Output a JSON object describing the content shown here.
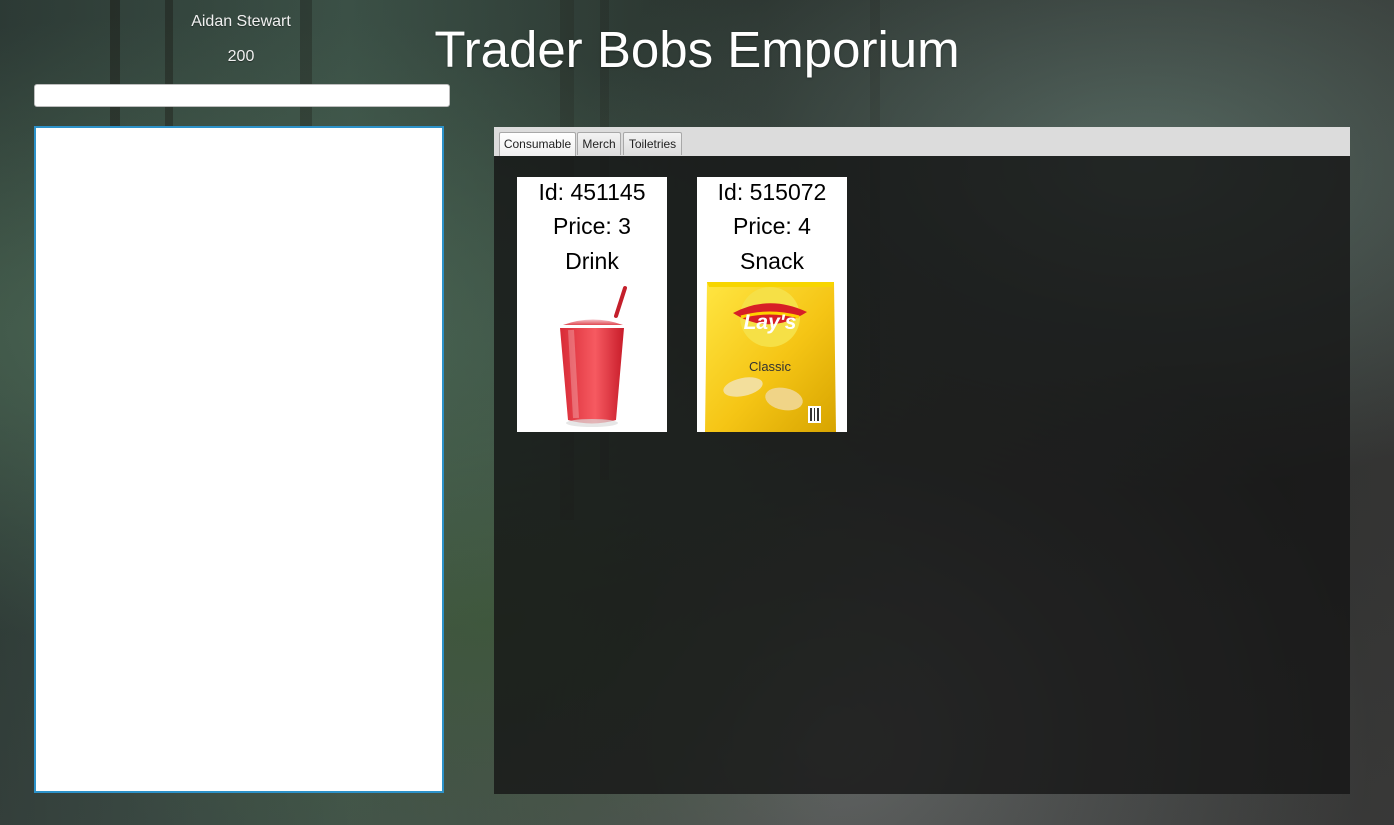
{
  "user": {
    "name": "Aidan Stewart",
    "balance": "200"
  },
  "store": {
    "title": "Trader Bobs Emporium"
  },
  "search": {
    "value": "",
    "placeholder": ""
  },
  "cart": {
    "items": []
  },
  "tabs": [
    {
      "label": "Consumable",
      "active": true
    },
    {
      "label": "Merch",
      "active": false
    },
    {
      "label": "Toiletries",
      "active": false
    }
  ],
  "products": [
    {
      "id_label": "Id: 451145",
      "price_label": "Price: 3",
      "name": "Drink",
      "image_icon": "red-drink-cup"
    },
    {
      "id_label": "Id: 515072",
      "price_label": "Price: 4",
      "name": "Snack",
      "image_icon": "chips-bag"
    }
  ],
  "chips_bag": {
    "brand": "Lay's",
    "flavor": "Classic"
  },
  "colors": {
    "selection_border": "#2d92c9",
    "tab_bar": "#dcdcdc",
    "pane_overlay": "#141414"
  }
}
